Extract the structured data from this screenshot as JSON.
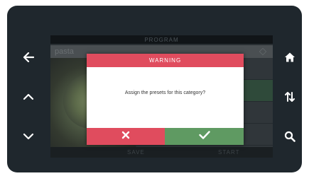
{
  "device": {
    "background": "#1f272d",
    "left_buttons": [
      {
        "icon": "arrow-left-icon"
      },
      {
        "icon": "chevron-up-icon"
      },
      {
        "icon": "chevron-down-icon"
      }
    ],
    "right_buttons": [
      {
        "icon": "home-icon"
      },
      {
        "icon": "sort-arrows-icon"
      },
      {
        "icon": "search-icon"
      }
    ]
  },
  "screen": {
    "title": "PROGRAM",
    "field_value": "pasta",
    "bottom_left_label": "SAVE",
    "bottom_right_label": "START"
  },
  "dialog": {
    "title": "WARNING",
    "message": "Assign the presets for this category?",
    "cancel_icon": "close-icon",
    "confirm_icon": "check-icon",
    "colors": {
      "header": "#e04c5e",
      "cancel": "#e04c5e",
      "confirm": "#5f9a62"
    }
  }
}
